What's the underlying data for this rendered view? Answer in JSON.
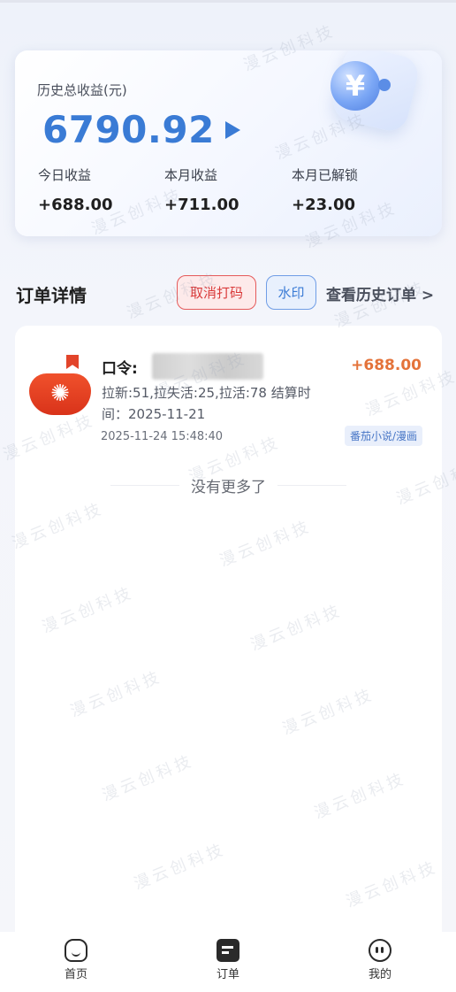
{
  "earnings": {
    "title": "历史总收益(元)",
    "total": "6790.92",
    "stats": [
      {
        "label": "今日收益",
        "value": "+688.00"
      },
      {
        "label": "本月收益",
        "value": "+711.00"
      },
      {
        "label": "本月已解锁",
        "value": "+23.00"
      }
    ],
    "yen_symbol": "¥"
  },
  "orders_section": {
    "title": "订单详情",
    "cancel_button": "取消打码",
    "watermark_button": "水印",
    "history_link": "查看历史订单 >"
  },
  "order": {
    "code_label": "口令:",
    "amount": "+688.00",
    "description": "拉新:51,拉失活:25,拉活:78 结算时间：2025-11-21",
    "time": "2025-11-24 15:48:40",
    "tag": "番茄小说/漫画",
    "logo_icon": "tomato-novel-icon"
  },
  "list_end_text": "没有更多了",
  "watermark_text": "漫云创科技",
  "nav": {
    "home": "首页",
    "orders": "订单",
    "mine": "我的"
  },
  "colors": {
    "accent_blue": "#3a7bd5",
    "amount_orange": "#e4733a",
    "cancel_red": "#d93a3a"
  }
}
